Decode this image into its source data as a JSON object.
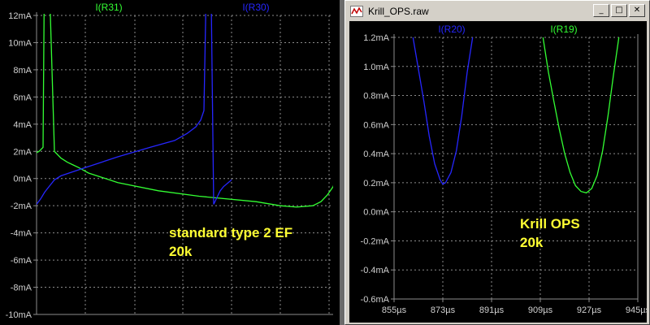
{
  "colors": {
    "background": "#000000",
    "grid": "#8c8c8c",
    "tick_text": "#d0d0d0",
    "green": "#33ff33",
    "blue": "#2626ff",
    "annotation": "#ffff33",
    "window_chrome": "#d4d0c8"
  },
  "window": {
    "title": "Krill_OPS.raw",
    "icon": "waveform-icon",
    "buttons": [
      {
        "name": "minimize-button",
        "icon": "minimize-icon",
        "glyph": "_"
      },
      {
        "name": "maximize-button",
        "icon": "maximize-icon",
        "glyph": "□"
      },
      {
        "name": "close-button",
        "icon": "close-icon",
        "glyph": "✕"
      }
    ]
  },
  "chart_data": [
    {
      "type": "line",
      "title": "",
      "xlabel": "",
      "ylabel": "",
      "y_ticks": [
        "12mA",
        "10mA",
        "8mA",
        "6mA",
        "4mA",
        "2mA",
        "0mA",
        "-2mA",
        "-4mA",
        "-6mA",
        "-8mA",
        "-10mA"
      ],
      "y_tick_values": [
        12,
        10,
        8,
        6,
        4,
        2,
        0,
        -2,
        -4,
        -6,
        -8,
        -10
      ],
      "ylim": [
        -10,
        12
      ],
      "y_unit": "mA",
      "x_ticks_visible": false,
      "grid": true,
      "series": [
        {
          "name": "I(R31)",
          "color": "#33ff33",
          "x": [
            0,
            3,
            8,
            10,
            14,
            22,
            30,
            38,
            45,
            52,
            58,
            64,
            100,
            150,
            200,
            270,
            300,
            320,
            340,
            350,
            358,
            365,
            370,
            376,
            380,
            384,
            385
          ],
          "y": [
            1.9,
            2.0,
            2.3,
            18,
            18,
            2.0,
            1.5,
            1.2,
            1.0,
            0.8,
            0.6,
            0.4,
            -0.3,
            -0.9,
            -1.3,
            -1.7,
            -2.0,
            -2.1,
            -2.0,
            -1.7,
            -1.2,
            -0.6,
            0.3,
            1.6,
            2.5,
            4.5,
            18
          ]
        },
        {
          "name": "I(R30)",
          "color": "#2626ff",
          "x": [
            0,
            5,
            10,
            14,
            18,
            22,
            30,
            60,
            100,
            140,
            170,
            185,
            196,
            202,
            206,
            210,
            214,
            218,
            222,
            226,
            230,
            240
          ],
          "y": [
            -1.9,
            -1.5,
            -1.0,
            -0.7,
            -0.4,
            -0.1,
            0.2,
            0.8,
            1.6,
            2.3,
            2.8,
            3.3,
            3.8,
            4.3,
            5.0,
            18,
            18,
            -1.9,
            -1.4,
            -0.9,
            -0.6,
            -0.1
          ]
        }
      ],
      "annotation": [
        "standard type 2 EF",
        "20k"
      ]
    },
    {
      "type": "line",
      "title": "",
      "xlabel": "",
      "ylabel": "",
      "x_ticks": [
        "855µs",
        "873µs",
        "891µs",
        "909µs",
        "927µs",
        "945µs"
      ],
      "x_tick_values": [
        855,
        873,
        891,
        909,
        927,
        945
      ],
      "xlim": [
        855,
        945
      ],
      "x_unit": "µs",
      "y_ticks": [
        "1.2mA",
        "1.0mA",
        "0.8mA",
        "0.6mA",
        "0.4mA",
        "0.2mA",
        "0.0mA",
        "-0.2mA",
        "-0.4mA",
        "-0.6mA"
      ],
      "y_tick_values": [
        1.2,
        1.0,
        0.8,
        0.6,
        0.4,
        0.2,
        0.0,
        -0.2,
        -0.4,
        -0.6
      ],
      "ylim": [
        -0.6,
        1.2
      ],
      "y_unit": "mA",
      "grid": true,
      "series": [
        {
          "name": "I(R20)",
          "color": "#2626ff",
          "x": [
            862,
            864,
            866,
            868,
            870,
            872,
            873,
            874,
            876,
            878,
            880,
            882,
            884
          ],
          "y": [
            1.2,
            0.98,
            0.76,
            0.52,
            0.33,
            0.22,
            0.19,
            0.2,
            0.27,
            0.42,
            0.66,
            0.96,
            1.2
          ]
        },
        {
          "name": "I(R19)",
          "color": "#33ff33",
          "x": [
            910,
            912,
            914,
            916,
            918,
            920,
            922,
            924,
            926,
            928,
            930,
            932,
            934,
            936,
            938
          ],
          "y": [
            1.2,
            0.96,
            0.76,
            0.57,
            0.4,
            0.27,
            0.18,
            0.14,
            0.13,
            0.16,
            0.25,
            0.42,
            0.66,
            0.94,
            1.2
          ]
        }
      ],
      "annotation": [
        "Krill OPS",
        "20k"
      ]
    }
  ]
}
